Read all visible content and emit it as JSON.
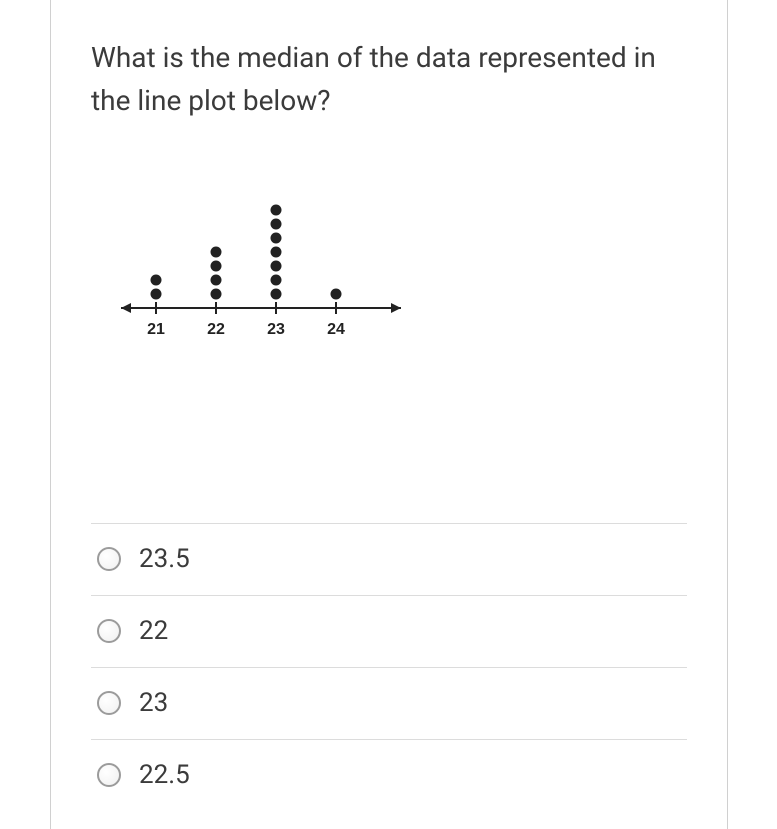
{
  "question": "What is the median of the data represented in the line plot below?",
  "answers": [
    {
      "label": "23.5"
    },
    {
      "label": "22"
    },
    {
      "label": "23"
    },
    {
      "label": "22.5"
    }
  ],
  "chart_data": {
    "type": "dotplot",
    "categories": [
      "21",
      "22",
      "23",
      "24"
    ],
    "values": [
      2,
      4,
      7,
      1
    ],
    "xlabel": "",
    "ylabel": ""
  }
}
